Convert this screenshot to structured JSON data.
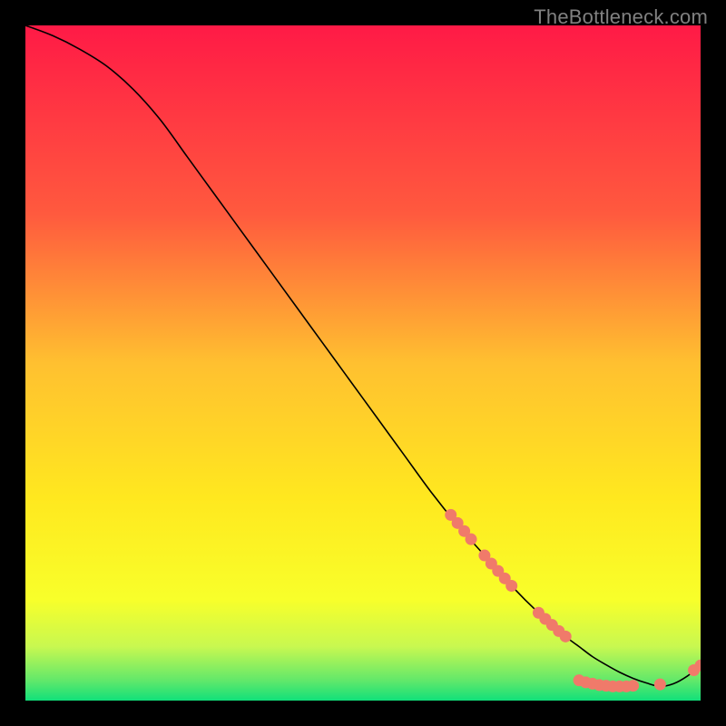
{
  "watermark": "TheBottleneck.com",
  "colors": {
    "background": "#000000",
    "gradient_top": "#ff1a46",
    "gradient_upper_mid": "#ff6a3a",
    "gradient_mid": "#ffc030",
    "gradient_lower_mid": "#fff81f",
    "gradient_near_bottom": "#c0f54a",
    "gradient_bottom": "#11e07a",
    "curve": "#000000",
    "marker_fill": "#f07a6a",
    "marker_stroke": "#f07a6a"
  },
  "chart_data": {
    "type": "line",
    "title": "",
    "xlabel": "",
    "ylabel": "",
    "xlim": [
      0,
      100
    ],
    "ylim": [
      0,
      100
    ],
    "legend": false,
    "grid": false,
    "annotations": [],
    "series": [
      {
        "name": "curve",
        "x": [
          0,
          4,
          8,
          12,
          16,
          20,
          24,
          28,
          32,
          36,
          40,
          44,
          48,
          52,
          56,
          60,
          64,
          68,
          72,
          76,
          80,
          82,
          84,
          86,
          88,
          90,
          92,
          94,
          96,
          98,
          100
        ],
        "y": [
          100,
          98.5,
          96.5,
          94,
          90.5,
          86,
          80.5,
          75,
          69.5,
          64,
          58.5,
          53,
          47.5,
          42,
          36.5,
          31,
          26,
          21.5,
          17,
          13,
          9.5,
          8,
          6.5,
          5.3,
          4.2,
          3.3,
          2.6,
          2.1,
          2.5,
          3.6,
          5.2
        ]
      }
    ],
    "markers": [
      {
        "x": 63,
        "y": 27.5
      },
      {
        "x": 64,
        "y": 26.3
      },
      {
        "x": 65,
        "y": 25.1
      },
      {
        "x": 66,
        "y": 23.9
      },
      {
        "x": 68,
        "y": 21.5
      },
      {
        "x": 69,
        "y": 20.3
      },
      {
        "x": 70,
        "y": 19.2
      },
      {
        "x": 71,
        "y": 18.1
      },
      {
        "x": 72,
        "y": 17.0
      },
      {
        "x": 76,
        "y": 13.0
      },
      {
        "x": 77,
        "y": 12.1
      },
      {
        "x": 78,
        "y": 11.2
      },
      {
        "x": 79,
        "y": 10.3
      },
      {
        "x": 80,
        "y": 9.5
      },
      {
        "x": 82,
        "y": 3.0
      },
      {
        "x": 83,
        "y": 2.7
      },
      {
        "x": 84,
        "y": 2.5
      },
      {
        "x": 85,
        "y": 2.3
      },
      {
        "x": 86,
        "y": 2.2
      },
      {
        "x": 87,
        "y": 2.1
      },
      {
        "x": 88,
        "y": 2.1
      },
      {
        "x": 89,
        "y": 2.1
      },
      {
        "x": 90,
        "y": 2.2
      },
      {
        "x": 94,
        "y": 2.4
      },
      {
        "x": 99,
        "y": 4.5
      },
      {
        "x": 100,
        "y": 5.2
      }
    ]
  }
}
